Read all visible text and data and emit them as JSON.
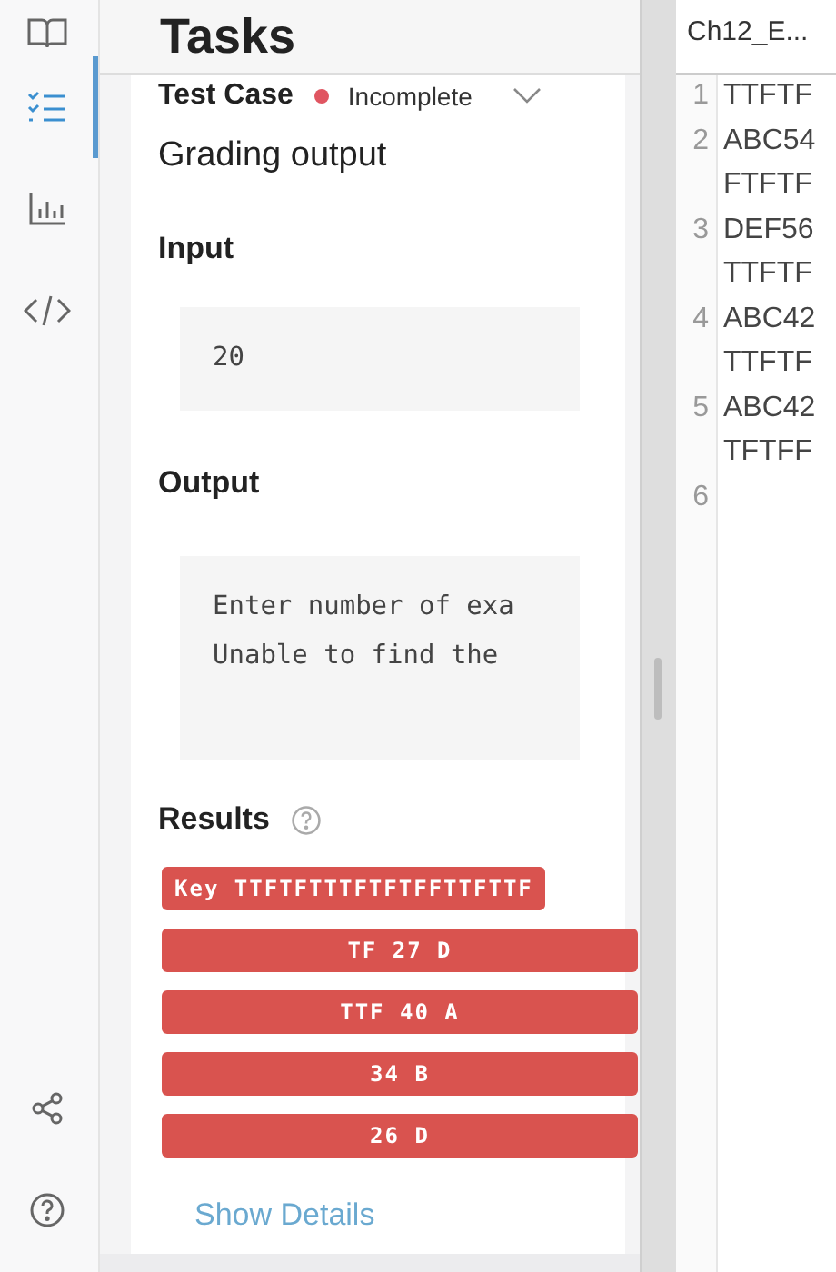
{
  "rail": {
    "items": [
      {
        "kind": "book",
        "selected": false
      },
      {
        "kind": "checklist",
        "selected": true
      },
      {
        "kind": "chart",
        "selected": false
      },
      {
        "kind": "code",
        "selected": false
      }
    ],
    "bottom": [
      {
        "kind": "share"
      },
      {
        "kind": "help"
      }
    ]
  },
  "panel": {
    "title": "Tasks",
    "test_case": {
      "label": "Test Case",
      "status": "Incomplete",
      "expanded": false
    },
    "subtitle": "Grading output",
    "input": {
      "label": "Input",
      "lines": [
        "20"
      ]
    },
    "output": {
      "label": "Output",
      "lines": [
        "Enter number of exa",
        "Unable to find the"
      ]
    },
    "results": {
      "label": "Results",
      "items": [
        {
          "kind": "key",
          "text": "Key TTFTFTTTFTFTFFTTFTTF"
        },
        {
          "kind": "answer",
          "text": "TF 27 D"
        },
        {
          "kind": "answer",
          "text": "TTF 40 A"
        },
        {
          "kind": "answer",
          "text": "34 B"
        },
        {
          "kind": "answer",
          "text": "26 D"
        }
      ]
    },
    "link": "Show Details"
  },
  "editor": {
    "tab": "Ch12_E...",
    "lines": [
      {
        "number": "1",
        "text": [
          "TTFTF"
        ]
      },
      {
        "number": "2",
        "text": [
          "ABC54",
          "FTFTF"
        ]
      },
      {
        "number": "3",
        "text": [
          "DEF56",
          "TTFTF"
        ]
      },
      {
        "number": "4",
        "text": [
          "ABC42",
          "TTFTF"
        ]
      },
      {
        "number": "5",
        "text": [
          "ABC42",
          "TFTFF"
        ]
      },
      {
        "number": "6"
      }
    ]
  }
}
